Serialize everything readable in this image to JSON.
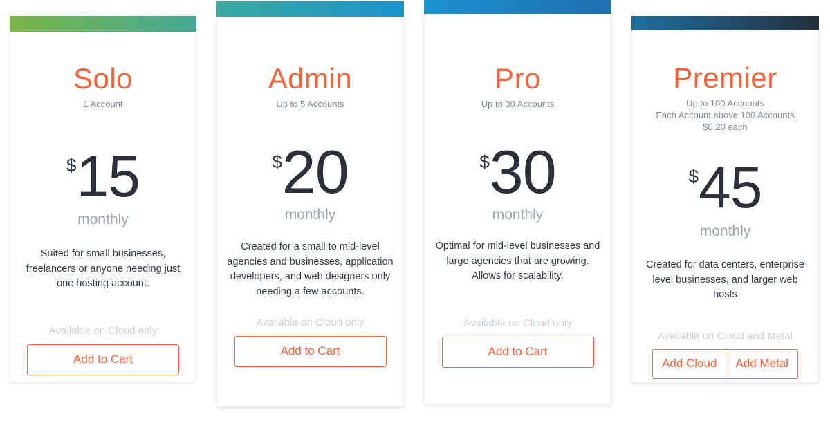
{
  "theme": {
    "accent": "#f4633a",
    "button_border": "#f06a3c",
    "price_color": "#2b303a",
    "subtitle_color": "#7e8b96",
    "availability_color": "#ccd1d7",
    "description_color": "#333c44",
    "card_background": "#ffffff",
    "page_background": "#ffffff"
  },
  "plans": [
    {
      "id": "solo",
      "name": "Solo",
      "subtitles": [
        "1 Account"
      ],
      "currency": "$",
      "amount": "15",
      "period": "monthly",
      "description": "Suited for small businesses, freelancers or anyone needing just one hosting account.",
      "availability": "Available on Cloud only",
      "buttons": [
        {
          "label": "Add to Cart",
          "name": "add-to-cart-button"
        }
      ],
      "topbar": {
        "from": "#7ab648",
        "to": "#45a994",
        "gradient": "linear-gradient(90deg, #7ab648 0%, #45a994 100%)"
      }
    },
    {
      "id": "admin",
      "name": "Admin",
      "subtitles": [
        "Up to 5 Accounts"
      ],
      "currency": "$",
      "amount": "20",
      "period": "monthly",
      "description": "Created for a small to mid-level agencies and businesses, application developers, and web designers only needing a few accounts.",
      "availability": "Available on Cloud only",
      "buttons": [
        {
          "label": "Add to Cart",
          "name": "add-to-cart-button"
        }
      ],
      "topbar": {
        "from": "#3aab9e",
        "to": "#1b93cf",
        "gradient": "linear-gradient(90deg, #3aab9e 0%, #1b93cf 100%)"
      }
    },
    {
      "id": "pro",
      "name": "Pro",
      "subtitles": [
        "Up to 30 Accounts"
      ],
      "currency": "$",
      "amount": "30",
      "period": "monthly",
      "description": "Optimal for mid-level businesses and large agencies that are growing. Allows for scalability.",
      "availability": "Available on Cloud only",
      "buttons": [
        {
          "label": "Add to Cart",
          "name": "add-to-cart-button"
        }
      ],
      "topbar": {
        "from": "#1b93cf",
        "to": "#1f6eae",
        "gradient": "linear-gradient(90deg, #1b93cf 0%, #1f6eae 100%)"
      }
    },
    {
      "id": "premier",
      "name": "Premier",
      "subtitles": [
        "Up to 100 Accounts",
        "Each Account above 100 Accounts",
        "$0.20 each"
      ],
      "currency": "$",
      "amount": "45",
      "period": "monthly",
      "description": "Created for data centers, enterprise level businesses, and larger web hosts",
      "availability": "Available on Cloud and Metal",
      "buttons": [
        {
          "label": "Add Cloud",
          "name": "add-cloud-button"
        },
        {
          "label": "Add Metal",
          "name": "add-metal-button"
        }
      ],
      "topbar": {
        "from": "#1f6f9e",
        "to": "#242f3d",
        "gradient": "linear-gradient(90deg, #1f6f9e 0%, #242f3d 100%)"
      }
    }
  ]
}
